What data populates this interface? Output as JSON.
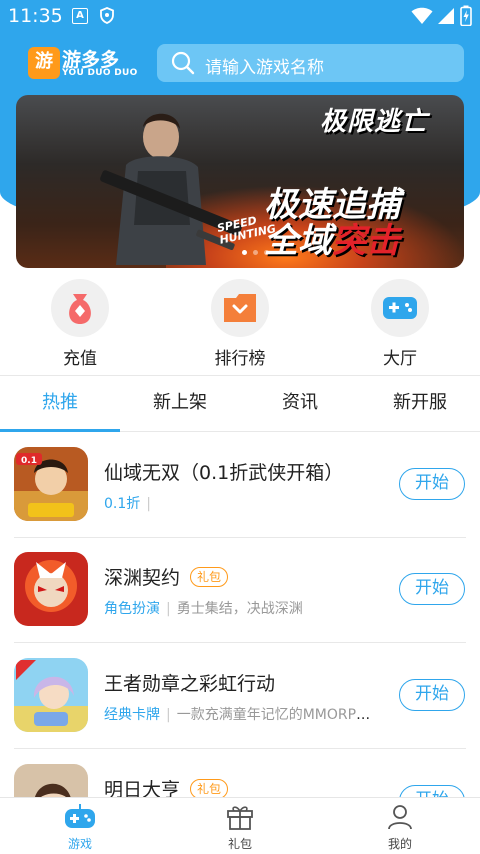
{
  "status_bar": {
    "time": "11:35",
    "notif_a": "A"
  },
  "header": {
    "logo_glyph": "游",
    "logo_name": "游多多",
    "logo_sub": "YOU DUO DUO",
    "search_placeholder": "请输入游戏名称",
    "accent": "#2fa6ec"
  },
  "banner": {
    "title": "极限逃亡",
    "slogan_line1": "极速追捕",
    "slogan_line2a": "全域",
    "slogan_line2b": "突击",
    "en_line1": "SPEED",
    "en_line2": "HUNTING",
    "slide_count": 3,
    "active_slide": 1
  },
  "quick": [
    {
      "label": "充值",
      "icon": "money-bag-icon"
    },
    {
      "label": "排行榜",
      "icon": "rank-folder-icon"
    },
    {
      "label": "大厅",
      "icon": "gamepad-icon"
    }
  ],
  "tabs": [
    {
      "label": "热推",
      "active": true
    },
    {
      "label": "新上架",
      "active": false
    },
    {
      "label": "资讯",
      "active": false
    },
    {
      "label": "新开服",
      "active": false
    }
  ],
  "games": [
    {
      "name": "仙域无双（0.1折武侠开箱）",
      "gift": "",
      "category": "0.1折",
      "desc": "",
      "button": "开始",
      "badge": "0.1折"
    },
    {
      "name": "深渊契约",
      "gift": "礼包",
      "category": "角色扮演",
      "desc": "勇士集结，决战深渊",
      "button": "开始",
      "badge": ""
    },
    {
      "name": "王者勋章之彩虹行动",
      "gift": "",
      "category": "经典卡牌",
      "desc": "一款充满童年记忆的MMORPG卡牌手游",
      "button": "开始",
      "badge": "正版"
    },
    {
      "name": "明日大亨",
      "gift": "礼包",
      "category": "",
      "desc": "",
      "button": "开始",
      "badge": ""
    }
  ],
  "bottom_nav": [
    {
      "label": "游戏",
      "icon": "game-controller-icon",
      "active": true
    },
    {
      "label": "礼包",
      "icon": "gift-box-icon",
      "active": false
    },
    {
      "label": "我的",
      "icon": "user-icon",
      "active": false
    }
  ]
}
